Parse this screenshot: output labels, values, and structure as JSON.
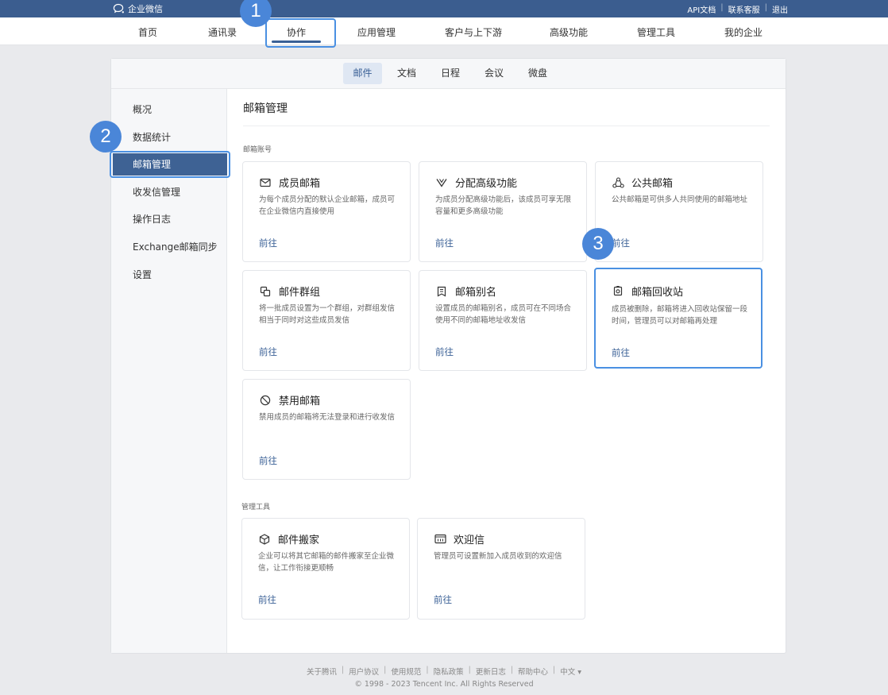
{
  "brand": {
    "name": "企业微信"
  },
  "top_links": [
    "API文档",
    "联系客服",
    "退出"
  ],
  "main_nav": [
    "首页",
    "通讯录",
    "协作",
    "应用管理",
    "客户与上下游",
    "高级功能",
    "管理工具",
    "我的企业"
  ],
  "sub_nav": [
    "邮件",
    "文档",
    "日程",
    "会议",
    "微盘"
  ],
  "sidebar": [
    "概况",
    "数据统计",
    "邮箱管理",
    "收发信管理",
    "操作日志",
    "Exchange邮箱同步",
    "设置"
  ],
  "page_title": "邮箱管理",
  "sections": {
    "accounts": "邮箱账号",
    "tools": "管理工具"
  },
  "cards": [
    {
      "title": "成员邮箱",
      "desc": "为每个成员分配的默认企业邮箱，成员可在企业微信内直接使用",
      "link": "前往",
      "icon": "mail-icon"
    },
    {
      "title": "分配高级功能",
      "desc": "为成员分配高级功能后，该成员可享无限容量和更多高级功能",
      "link": "前往",
      "icon": "vip-icon"
    },
    {
      "title": "公共邮箱",
      "desc": "公共邮箱是可供多人共同使用的邮箱地址",
      "link": "前往",
      "icon": "shared-icon"
    },
    {
      "title": "邮件群组",
      "desc": "将一批成员设置为一个群组，对群组发信相当于同时对这些成员发信",
      "link": "前往",
      "icon": "group-icon"
    },
    {
      "title": "邮箱别名",
      "desc": "设置成员的邮箱别名，成员可在不同场合使用不同的邮箱地址收发信",
      "link": "前往",
      "icon": "alias-icon"
    },
    {
      "title": "邮箱回收站",
      "desc": "成员被删除，邮箱将进入回收站保留一段时间，管理员可以对邮箱再处理",
      "link": "前往",
      "icon": "recycle-icon"
    },
    {
      "title": "禁用邮箱",
      "desc": "禁用成员的邮箱将无法登录和进行收发信",
      "link": "前往",
      "icon": "ban-icon"
    }
  ],
  "tool_cards": [
    {
      "title": "邮件搬家",
      "desc": "企业可以将其它邮箱的邮件搬家至企业微信，让工作衔接更顺畅",
      "link": "前往",
      "icon": "box-icon"
    },
    {
      "title": "欢迎信",
      "desc": "管理员可设置新加入成员收到的欢迎信",
      "link": "前往",
      "icon": "welcome-icon"
    }
  ],
  "step_badges": [
    "1",
    "2",
    "3"
  ],
  "footer": {
    "links": [
      "关于腾讯",
      "用户协议",
      "使用规范",
      "隐私政策",
      "更新日志",
      "帮助中心",
      "中文 ▾"
    ],
    "copyright": "© 1998 - 2023 Tencent Inc. All Rights Reserved"
  },
  "colors": {
    "header": "#3b5d8f",
    "accent": "#3a6096",
    "highlight": "#4a90e2",
    "badge": "#4a86d8"
  }
}
